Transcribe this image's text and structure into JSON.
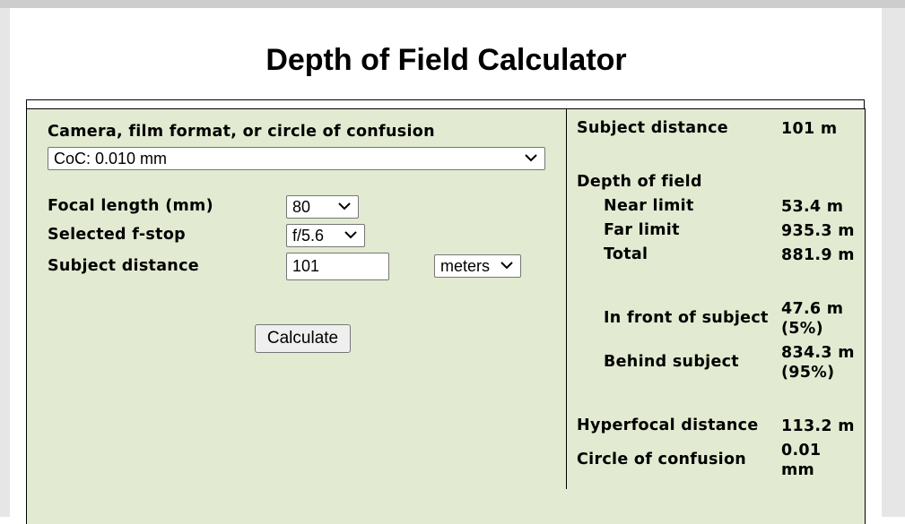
{
  "page": {
    "title": "Depth of Field Calculator"
  },
  "form": {
    "camera_label": "Camera, film format, or circle of confusion",
    "camera_value": "CoC: 0.010 mm",
    "focal_label": "Focal length (mm)",
    "focal_value": "80",
    "fstop_label": "Selected f-stop",
    "fstop_value": "f/5.6",
    "distance_label": "Subject distance",
    "distance_value": "101",
    "units_value": "meters",
    "calculate_label": "Calculate"
  },
  "results": {
    "subject_distance_label": "Subject distance",
    "subject_distance_value": "101 m",
    "dof_heading": "Depth of field",
    "near_label": "Near limit",
    "near_value": "53.4 m",
    "far_label": "Far limit",
    "far_value": "935.3 m",
    "total_label": "Total",
    "total_value": "881.9 m",
    "front_label": "In front of subject",
    "front_value_line1": "47.6 m",
    "front_value_line2": "(5%)",
    "behind_label": "Behind subject",
    "behind_value_line1": "834.3 m",
    "behind_value_line2": "(95%)",
    "hyperfocal_label": "Hyperfocal distance",
    "hyperfocal_value": "113.2 m",
    "coc_label": "Circle of confusion",
    "coc_value_line1": "0.01",
    "coc_value_line2": "mm"
  },
  "icons": {
    "dropdown": "chevron-down-icon"
  },
  "colors": {
    "panel_background": "#e2ebd1",
    "border": "#000000"
  }
}
